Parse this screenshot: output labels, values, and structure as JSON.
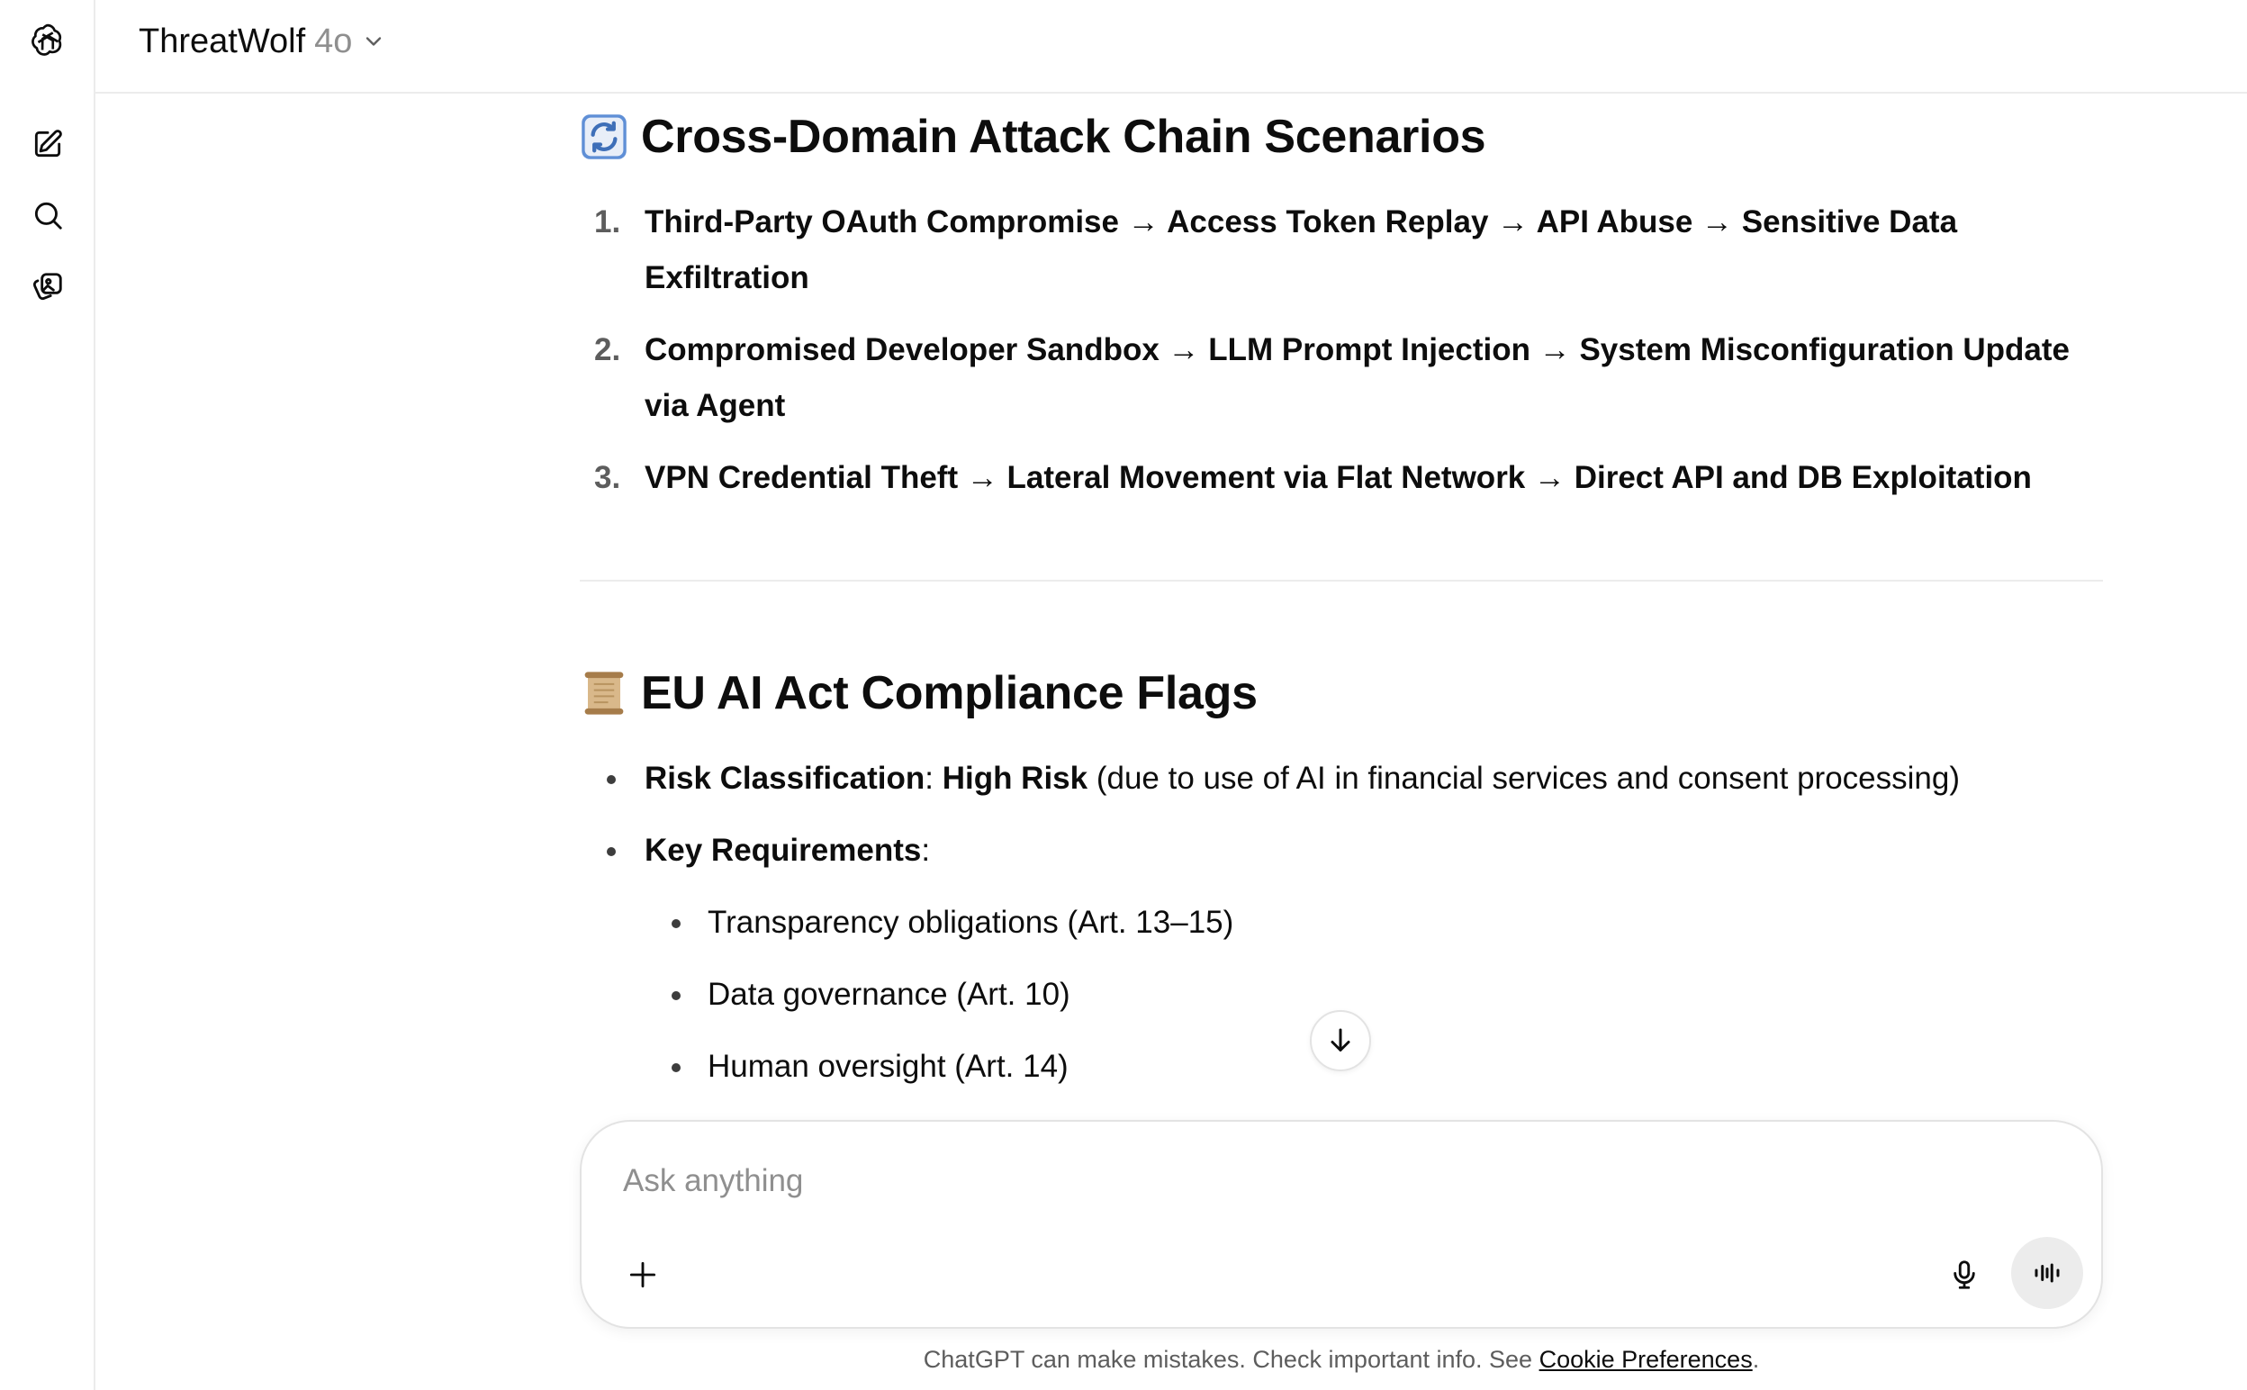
{
  "header": {
    "model_name": "ThreatWolf",
    "model_version": "4o"
  },
  "sidebar": {
    "icons": [
      "openai-logo-icon",
      "new-chat-icon",
      "search-icon",
      "library-icon"
    ]
  },
  "sections": {
    "attack_chains": {
      "emoji": "🔄",
      "title": "Cross-Domain Attack Chain Scenarios",
      "items": [
        {
          "num": "1.",
          "text": "Third-Party OAuth Compromise → Access Token Replay → API Abuse → Sensitive Data Exfiltration"
        },
        {
          "num": "2.",
          "text": "Compromised Developer Sandbox → LLM Prompt Injection → System Misconfiguration Update via Agent"
        },
        {
          "num": "3.",
          "text": "VPN Credential Theft → Lateral Movement via Flat Network → Direct API and DB Exploitation"
        }
      ]
    },
    "compliance": {
      "emoji": "📜",
      "title": "EU AI Act Compliance Flags",
      "risk_label": "Risk Classification",
      "risk_value": "High Risk",
      "risk_note": " (due to use of AI in financial services and consent processing)",
      "req_label": "Key Requirements",
      "requirements": [
        "Transparency obligations (Art. 13–15)",
        "Data governance (Art. 10)",
        "Human oversight (Art. 14)"
      ]
    }
  },
  "composer": {
    "placeholder": "Ask anything"
  },
  "footer": {
    "disclaimer": "ChatGPT can make mistakes. Check important info. See ",
    "link": "Cookie Preferences",
    "end": "."
  }
}
